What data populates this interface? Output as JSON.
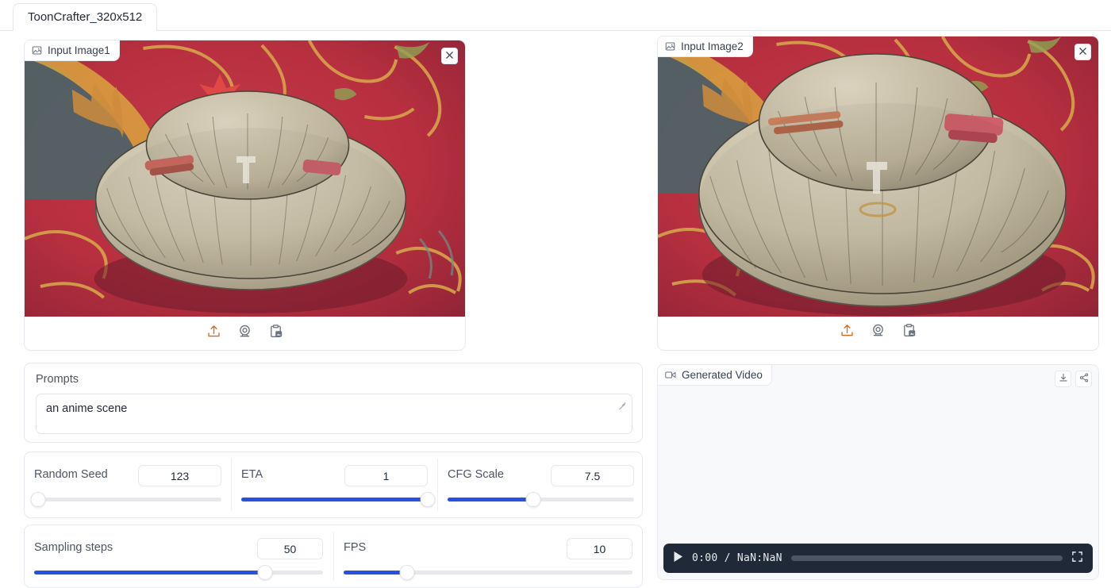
{
  "app": {
    "tab_label": "ToonCrafter_320x512"
  },
  "input_image1": {
    "badge_label": "Input Image1",
    "badge_icon": "image-icon",
    "close_icon": "close-icon",
    "tools": [
      {
        "name": "upload-icon",
        "label": "Upload"
      },
      {
        "name": "webcam-icon",
        "label": "Webcam"
      },
      {
        "name": "paste-clipboard-icon",
        "label": "Paste from clipboard"
      }
    ],
    "artwork_description": "Anime illustration of a pale round floor cushion resting on a red ornate patterned carpet"
  },
  "input_image2": {
    "badge_label": "Input Image2",
    "badge_icon": "image-icon",
    "close_icon": "close-icon",
    "tools": [
      {
        "name": "upload-icon",
        "label": "Upload"
      },
      {
        "name": "webcam-icon",
        "label": "Webcam"
      },
      {
        "name": "paste-clipboard-icon",
        "label": "Paste from clipboard"
      }
    ],
    "artwork_description": "Anime illustration of the same pale round floor cushion, closer view, on a red ornate patterned carpet"
  },
  "prompts": {
    "label": "Prompts",
    "value": "an anime scene",
    "placeholder": ""
  },
  "sliders": [
    {
      "name": "random-seed",
      "label": "Random Seed",
      "value": "123",
      "percent": 2,
      "fill_visible": false
    },
    {
      "name": "eta",
      "label": "ETA",
      "value": "1",
      "percent": 100,
      "fill_visible": true
    },
    {
      "name": "cfg-scale",
      "label": "CFG Scale",
      "value": "7.5",
      "percent": 46,
      "fill_visible": true
    },
    {
      "name": "sampling-steps",
      "label": "Sampling steps",
      "value": "50",
      "percent": 80,
      "fill_visible": true
    },
    {
      "name": "fps",
      "label": "FPS",
      "value": "10",
      "percent": 22,
      "fill_visible": true
    }
  ],
  "generated_video": {
    "badge_label": "Generated Video",
    "badge_icon": "video-camera-icon",
    "actions": [
      {
        "name": "download-icon",
        "label": "Download"
      },
      {
        "name": "share-icon",
        "label": "Share"
      }
    ],
    "player": {
      "play_icon": "play-icon",
      "current_time": "0:00",
      "separator": "/",
      "duration": "NaN:NaN",
      "time_display": "0:00 / NaN:NaN",
      "progress_percent": 0,
      "fullscreen_icon": "fullscreen-icon"
    }
  },
  "colors": {
    "accent_blue": "#2752e0",
    "upload_orange": "#d2691e",
    "player_bar": "#1f2937",
    "panel_border": "#e7e9ee",
    "label_text": "#4b5563"
  }
}
